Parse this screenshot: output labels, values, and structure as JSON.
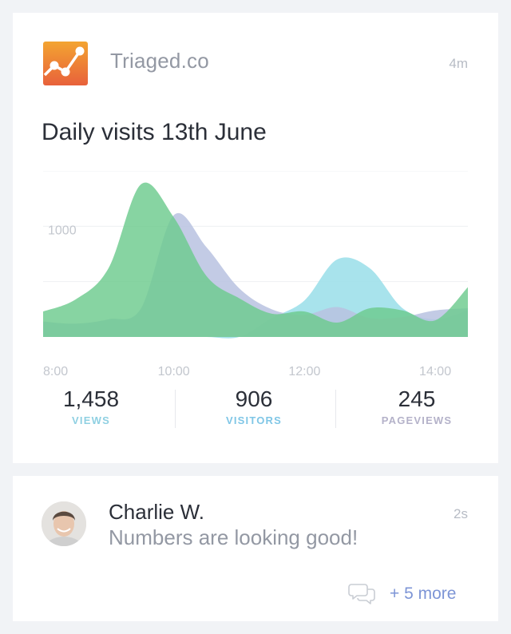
{
  "post": {
    "app_name": "Triaged.co",
    "time": "4m",
    "title": "Daily visits 13th June",
    "colors": {
      "logo_orange_top": "#f19a34",
      "logo_orange_bottom": "#e8683a",
      "green": "#6dcb8e",
      "purple": "#b9c2e0",
      "cyan": "#9fe0ea",
      "views_label": "#8fd0e2",
      "visitors_label": "#7fc6e6",
      "pageviews_label": "#b4b2c9"
    }
  },
  "chart_data": {
    "type": "area",
    "x": [
      "8:00",
      "8:30",
      "9:00",
      "9:30",
      "10:00",
      "10:30",
      "11:00",
      "11:30",
      "12:00",
      "12:30",
      "13:00",
      "13:30",
      "14:00",
      "14:30"
    ],
    "ytick_label": "1000",
    "ylim": [
      0,
      1500
    ],
    "series": [
      {
        "color": "#6dcb8e",
        "values": [
          230,
          340,
          620,
          1380,
          1080,
          550,
          350,
          210,
          230,
          130,
          260,
          240,
          150,
          450
        ]
      },
      {
        "color": "#b9c2e0",
        "values": [
          140,
          120,
          160,
          260,
          1100,
          810,
          440,
          250,
          200,
          270,
          170,
          180,
          240,
          260
        ]
      },
      {
        "color": "#9fe0ea",
        "values": [
          0,
          0,
          0,
          0,
          0,
          0,
          0,
          170,
          330,
          700,
          620,
          260,
          160,
          240
        ]
      }
    ],
    "xtick_labels": [
      "8:00",
      "10:00",
      "12:00",
      "14:00"
    ],
    "grid": true
  },
  "stats": [
    {
      "value": "1,458",
      "label": "VIEWS"
    },
    {
      "value": "906",
      "label": "VISITORS"
    },
    {
      "value": "245",
      "label": "PAGEVIEWS"
    }
  ],
  "comment": {
    "author": "Charlie W.",
    "message": "Numbers are looking good!",
    "time": "2s",
    "more": "+ 5 more",
    "icon": "comment-icon"
  }
}
